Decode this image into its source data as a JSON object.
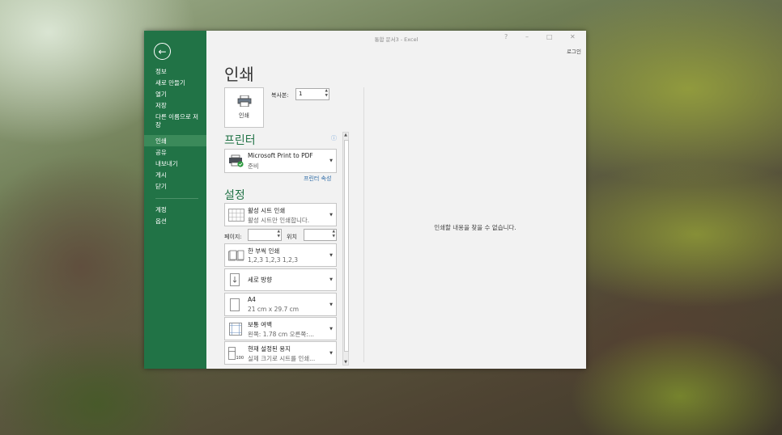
{
  "window": {
    "title": "통합 문서3 - Excel",
    "controls": {
      "help": "?",
      "minimize": "–",
      "maximize": "□",
      "close": "✕"
    },
    "login": "로그인"
  },
  "sidebar": {
    "back_icon": "back-arrow-icon",
    "items": [
      {
        "label": "정보"
      },
      {
        "label": "새로 만들기"
      },
      {
        "label": "열기"
      },
      {
        "label": "저장"
      },
      {
        "label": "다른 이름으로 저장"
      },
      {
        "label": "인쇄",
        "selected": true
      },
      {
        "label": "공유"
      },
      {
        "label": "내보내기"
      },
      {
        "label": "게시"
      },
      {
        "label": "닫기"
      }
    ],
    "bottom_items": [
      {
        "label": "계정"
      },
      {
        "label": "옵션"
      }
    ]
  },
  "print": {
    "title": "인쇄",
    "button_label": "인쇄",
    "copies_label": "복사본:",
    "copies_value": "1"
  },
  "printer": {
    "heading": "프린터",
    "name": "Microsoft Print to PDF",
    "status": "준비",
    "properties_link": "프린터 속성"
  },
  "settings": {
    "heading": "설정",
    "what": {
      "title": "활성 시트 인쇄",
      "sub": "활성 시트만 인쇄합니다."
    },
    "pages_label": "페이지:",
    "to_label": "위치",
    "collate": {
      "title": "한 부씩 인쇄",
      "sub": "1,2,3    1,2,3    1,2,3"
    },
    "orientation": {
      "title": "세로 방향"
    },
    "paper": {
      "title": "A4",
      "sub": "21 cm x 29.7 cm"
    },
    "margins": {
      "title": "보통 여백",
      "sub": "왼쪽:  1.78 cm    오른쪽:..."
    },
    "scaling": {
      "title": "현재 설정된 용지",
      "sub": "실제 크기로 시트를 인쇄..."
    }
  },
  "preview": {
    "message": "인쇄할 내용을 찾을 수 없습니다."
  },
  "colors": {
    "accent": "#217346",
    "selected": "#3b8a5a",
    "link": "#2c6aa6"
  }
}
